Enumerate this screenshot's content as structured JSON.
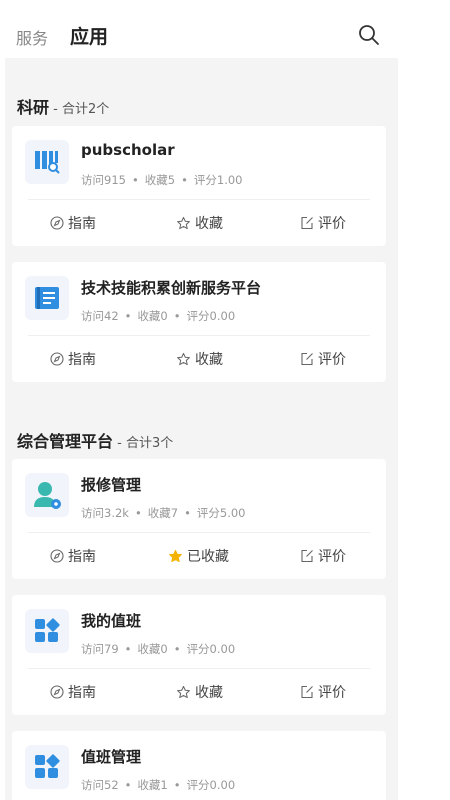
{
  "header": {
    "tab_services": "服务",
    "tab_apps": "应用",
    "search_icon": "search-icon"
  },
  "sections": [
    {
      "title": "科研",
      "count_label": " - 合计2个"
    },
    {
      "title": "综合管理平台",
      "count_label": " - 合计3个"
    }
  ],
  "apps": [
    {
      "name": "pubscholar",
      "visits": "访问915",
      "favorites": "收藏5",
      "rating": "评分1.00",
      "guide": "指南",
      "favorite_label": "收藏",
      "favorited": false,
      "review": "评价",
      "icon": "library-search-icon"
    },
    {
      "name": "技术技能积累创新服务平台",
      "visits": "访问42",
      "favorites": "收藏0",
      "rating": "评分0.00",
      "guide": "指南",
      "favorite_label": "收藏",
      "favorited": false,
      "review": "评价",
      "icon": "book-icon"
    },
    {
      "name": "报修管理",
      "visits": "访问3.2k",
      "favorites": "收藏7",
      "rating": "评分5.00",
      "guide": "指南",
      "favorite_label": "已收藏",
      "favorited": true,
      "review": "评价",
      "icon": "user-gear-icon"
    },
    {
      "name": "我的值班",
      "visits": "访问79",
      "favorites": "收藏0",
      "rating": "评分0.00",
      "guide": "指南",
      "favorite_label": "收藏",
      "favorited": false,
      "review": "评价",
      "icon": "grid-apps-icon"
    },
    {
      "name": "值班管理",
      "visits": "访问52",
      "favorites": "收藏1",
      "rating": "评分0.00",
      "icon": "grid-apps-icon"
    }
  ],
  "colors": {
    "accent": "#2f8ee0",
    "favorited_star": "#f5b301",
    "teal": "#39b8b0"
  }
}
